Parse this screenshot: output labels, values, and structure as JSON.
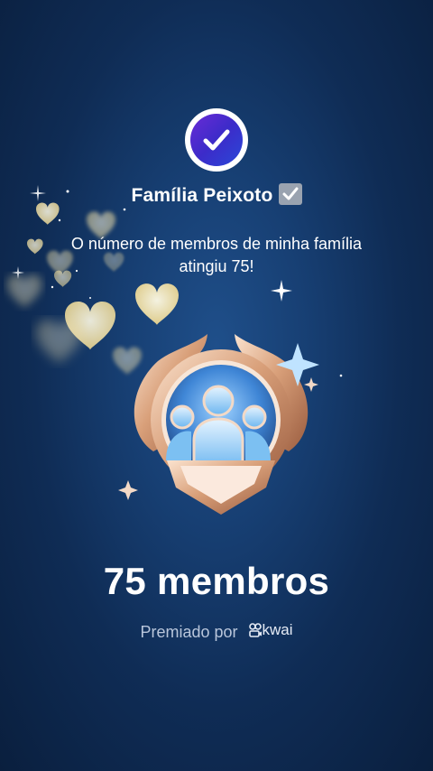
{
  "family": {
    "name": "Família Peixoto",
    "verified_icon": "check-box-icon",
    "avatar_icon": "verified-check-icon",
    "avatar_gradient": [
      "#6a2bd6",
      "#2a48d8"
    ]
  },
  "message": "O número de membros de minha família atingiu 75!",
  "milestone": {
    "label": "75 membros",
    "badge_icon": "family-members-medal-icon"
  },
  "footer": {
    "awarded_by": "Premiado por",
    "brand": "kwai",
    "brand_icon": "kwai-logo-icon"
  },
  "colors": {
    "background_center": "#1f4f8a",
    "background_edge": "#0a1f3e",
    "heart_glow": "#f6e7a8",
    "medal_rose_gold": "#d9a07a",
    "medal_blue": "#5aa8ea"
  }
}
